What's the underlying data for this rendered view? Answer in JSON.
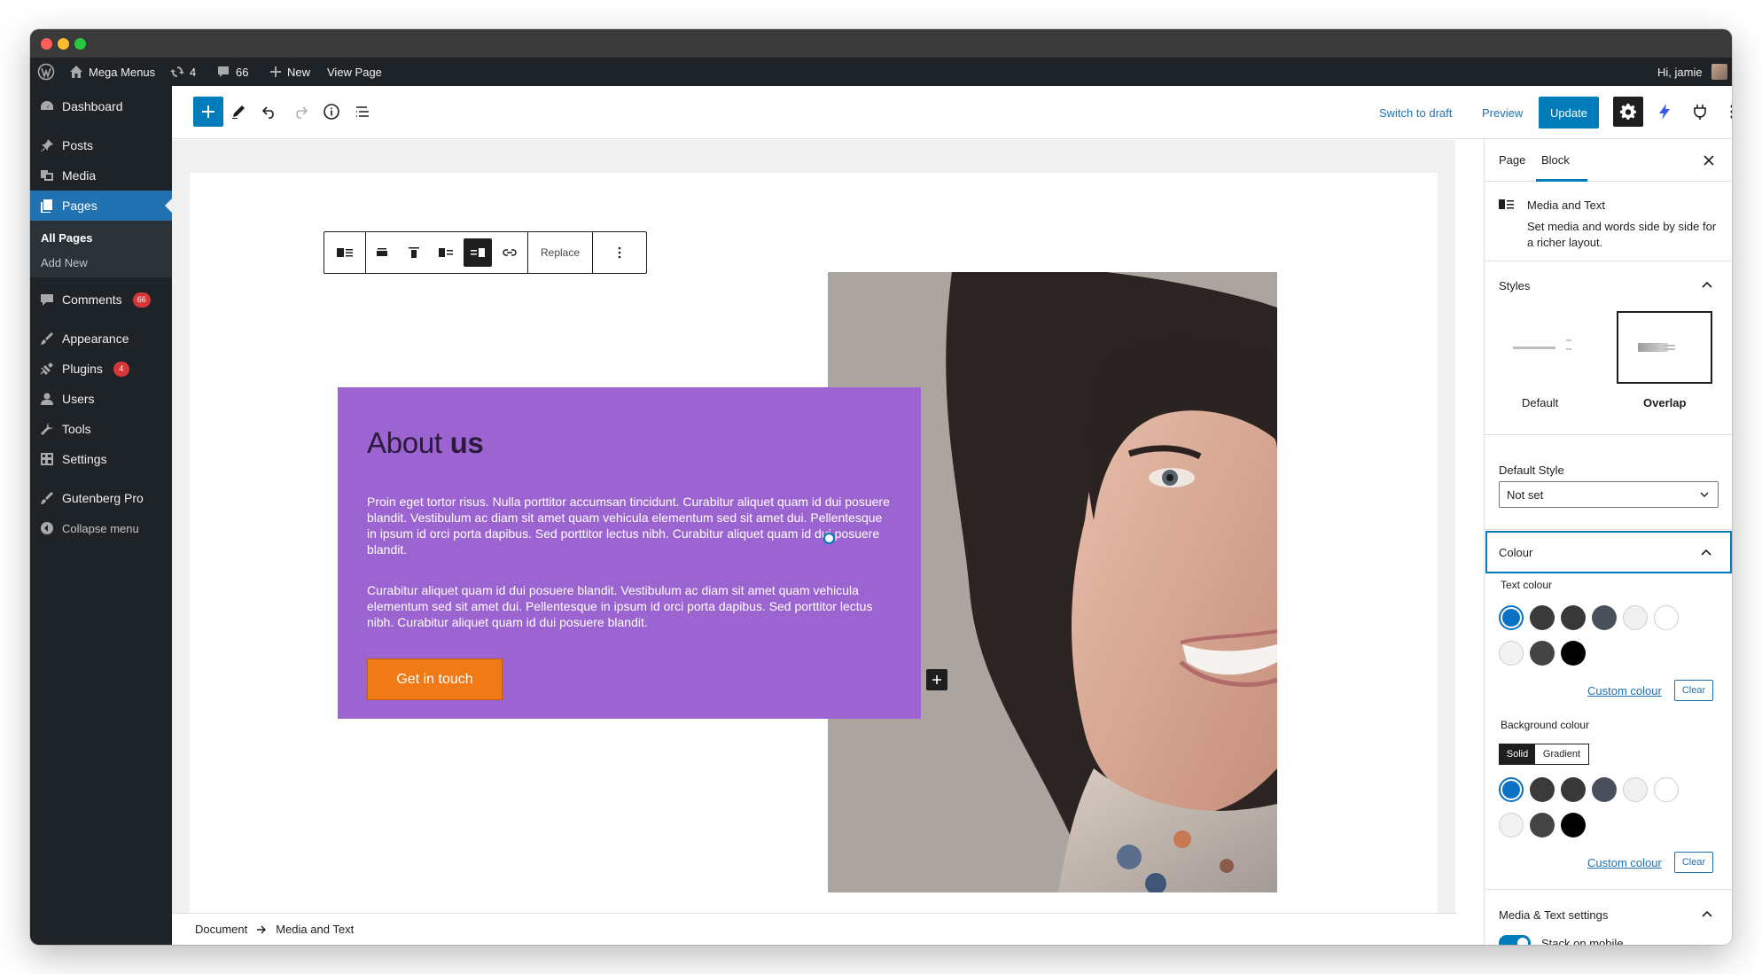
{
  "admin_bar": {
    "site_name": "Mega Menus",
    "updates_count": "4",
    "comments_count": "66",
    "new_label": "New",
    "view_page_label": "View Page",
    "greeting": "Hi, jamie"
  },
  "sidebar": {
    "items": [
      {
        "label": "Dashboard",
        "icon": "dashboard-icon"
      },
      {
        "label": "Posts",
        "icon": "pin-icon"
      },
      {
        "label": "Media",
        "icon": "media-icon"
      },
      {
        "label": "Pages",
        "icon": "pages-icon"
      },
      {
        "label": "Comments",
        "icon": "comment-icon",
        "badge": "66"
      },
      {
        "label": "Appearance",
        "icon": "brush-icon"
      },
      {
        "label": "Plugins",
        "icon": "plugin-icon",
        "badge": "4"
      },
      {
        "label": "Users",
        "icon": "user-icon"
      },
      {
        "label": "Tools",
        "icon": "wrench-icon"
      },
      {
        "label": "Settings",
        "icon": "settings-icon"
      },
      {
        "label": "Gutenberg Pro",
        "icon": "brush-icon"
      },
      {
        "label": "Collapse menu",
        "icon": "collapse-icon"
      }
    ],
    "submenu": [
      "All Pages",
      "Add New"
    ]
  },
  "toolbar": {
    "switch_draft": "Switch to draft",
    "preview": "Preview",
    "update": "Update"
  },
  "block_toolbar": {
    "replace": "Replace"
  },
  "content": {
    "heading_light": "About ",
    "heading_bold": "us",
    "para1": "Proin eget tortor risus. Nulla porttitor accumsan tincidunt. Curabitur aliquet quam id dui posuere blandit. Vestibulum ac diam sit amet quam vehicula elementum sed sit amet dui. Pellentesque in ipsum id orci porta dapibus. Sed porttitor lectus nibh. Curabitur aliquet quam id dui posuere blandit.",
    "para2": "Curabitur aliquet quam id dui posuere blandit. Vestibulum ac diam sit amet quam vehicula elementum sed sit amet dui. Pellentesque in ipsum id orci porta dapibus. Sed porttitor lectus nibh. Curabitur aliquet quam id dui posuere blandit.",
    "button": "Get in touch",
    "card_color": "#9c64d0",
    "button_color": "#f07b16"
  },
  "breadcrumb": {
    "root": "Document",
    "current": "Media and Text"
  },
  "panel": {
    "tab_page": "Page",
    "tab_block": "Block",
    "block_name": "Media and Text",
    "block_desc": "Set media and words side by side for a richer layout.",
    "styles_title": "Styles",
    "style_default": "Default",
    "style_overlap": "Overlap",
    "default_style_label": "Default Style",
    "default_style_value": "Not set",
    "colour_title": "Colour",
    "text_colour": "Text colour",
    "bg_colour": "Background colour",
    "solid": "Solid",
    "gradient": "Gradient",
    "custom_colour": "Custom colour",
    "clear": "Clear",
    "media_settings_title": "Media & Text settings",
    "stack_mobile": "Stack on mobile",
    "swatches": [
      "#0a72c4",
      "#3a3a3a",
      "#383838",
      "#4a4f5c",
      "#f0f0f0",
      "#ffffff",
      "#f2f2f2",
      "#444444",
      "#000000"
    ]
  }
}
